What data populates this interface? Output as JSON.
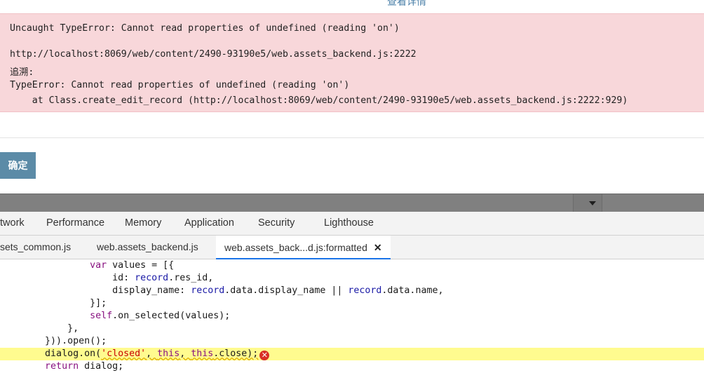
{
  "dialog": {
    "details_link": "查看详情",
    "error_lines": [
      "Uncaught TypeError: Cannot read properties of undefined (reading 'on')",
      "http://localhost:8069/web/content/2490-93190e5/web.assets_backend.js:2222",
      "追溯:",
      "TypeError: Cannot read properties of undefined (reading 'on')",
      "    at Class.create_edit_record (http://localhost:8069/web/content/2490-93190e5/web.assets_backend.js:2222:929)"
    ],
    "confirm_label": "确定",
    "error_bg": "#f8d7da",
    "button_bg": "#5c8ba7"
  },
  "devtools": {
    "panels": [
      "twork",
      "Performance",
      "Memory",
      "Application",
      "Security",
      "Lighthouse"
    ],
    "files": [
      "sets_common.js",
      "web.assets_backend.js",
      "web.assets_back...d.js:formatted"
    ],
    "active_file_index": 2,
    "close_glyph": "✕",
    "error_glyph": "✕",
    "highlight_color": "#fffb8f",
    "code": {
      "l1_kw": "var",
      "l1_rest": " values = [{",
      "l2_key": "id: ",
      "l2_a": "record",
      "l2_b": ".res_id,",
      "l3_key": "display_name: ",
      "l3_a": "record",
      "l3_b": ".data.display_name || ",
      "l3_c": "record",
      "l3_d": ".data.name,",
      "l4": "}];",
      "l5_kw": "self",
      "l5_rest": ".on_selected(values);",
      "l6": "},",
      "l7": "})).open();",
      "l8_a": "dialog.on(",
      "l8_str": "'closed'",
      "l8_b": ", ",
      "l8_kw1": "this",
      "l8_c": ", ",
      "l8_kw2": "this",
      "l8_d": ".close);",
      "l9_kw": "return",
      "l9_rest": " dialog;"
    }
  }
}
